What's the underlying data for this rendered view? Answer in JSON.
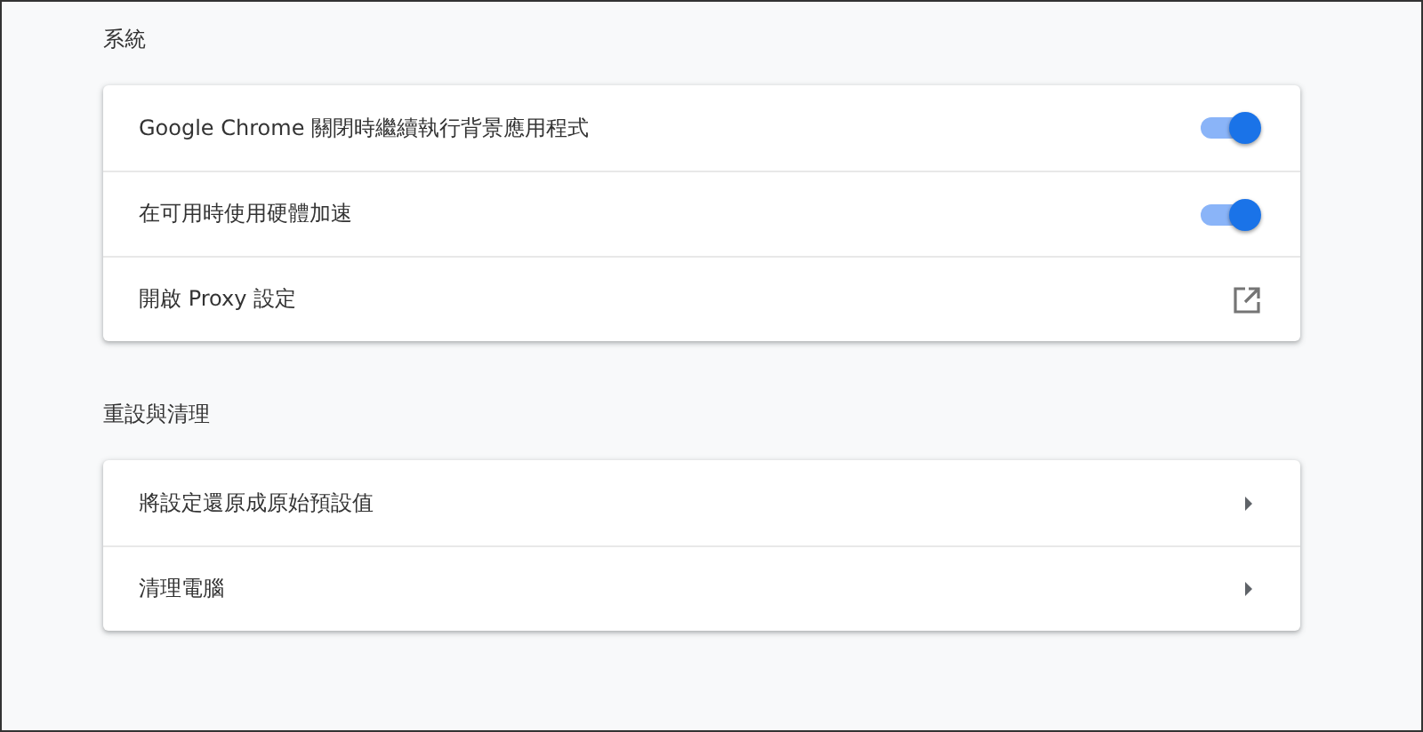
{
  "sections": [
    {
      "title": "系統",
      "rows": [
        {
          "kind": "toggle",
          "label": "Google Chrome 關閉時繼續執行背景應用程式",
          "on": true
        },
        {
          "kind": "toggle",
          "label": "在可用時使用硬體加速",
          "on": true
        },
        {
          "kind": "external",
          "label": "開啟 Proxy 設定"
        }
      ]
    },
    {
      "title": "重設與清理",
      "rows": [
        {
          "kind": "arrow",
          "label": "將設定還原成原始預設值"
        },
        {
          "kind": "arrow",
          "label": "清理電腦"
        }
      ]
    }
  ]
}
